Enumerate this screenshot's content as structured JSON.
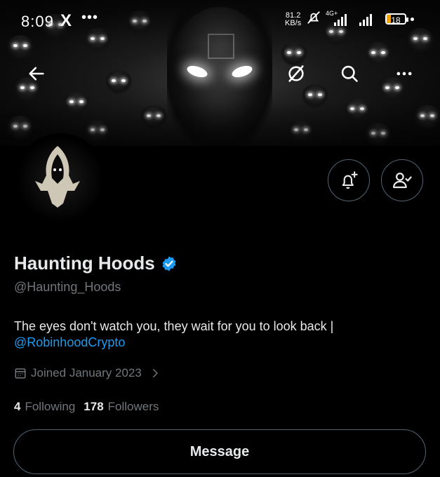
{
  "status_bar": {
    "time": "8:09",
    "x_label": "X",
    "dots": "•••",
    "speed_value": "81.2",
    "speed_unit": "KB/s",
    "network": "4G+",
    "battery": "18"
  },
  "profile": {
    "display_name": "Haunting Hoods",
    "handle": "@Haunting_Hoods",
    "bio_text": "The eyes don't watch you, they wait for you to look back |",
    "bio_link": "@RobinhoodCrypto",
    "joined": "Joined January 2023",
    "following_count": "4",
    "following_label": "Following",
    "followers_count": "178",
    "followers_label": "Followers"
  },
  "actions": {
    "message_label": "Message"
  },
  "icons": {
    "back": "back-arrow-icon",
    "grok": "grok-icon",
    "search": "search-icon",
    "more": "more-icon",
    "notify": "bell-plus-icon",
    "following": "person-check-icon",
    "verified": "verified-badge-icon",
    "calendar": "calendar-icon",
    "chevron": "chevron-right-icon"
  },
  "colors": {
    "accent": "#1d9bf0",
    "muted": "#71767b",
    "text": "#e7e9ea",
    "background": "#000000"
  }
}
